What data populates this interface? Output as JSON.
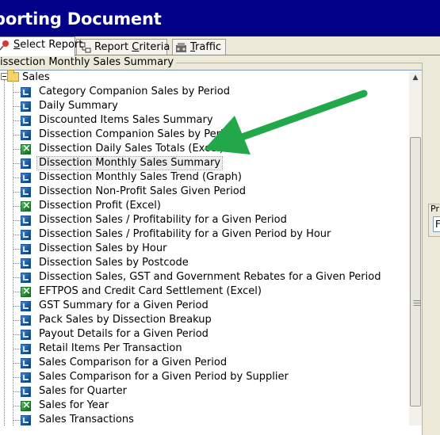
{
  "window": {
    "title": "eporting Document"
  },
  "tabs": [
    {
      "label_pre": "",
      "label_ul": "S",
      "label_post": "elect Report",
      "icon": "pin-icon",
      "active": true
    },
    {
      "label_pre": "Report ",
      "label_ul": "C",
      "label_post": "riteria",
      "icon": "criteria-icon",
      "active": false
    },
    {
      "label_pre": "",
      "label_ul": "T",
      "label_post": "raffic",
      "icon": "traffic-icon",
      "active": false
    }
  ],
  "group": {
    "label": "issection Monthly Sales Summary"
  },
  "tree": {
    "root": "Sales",
    "items": [
      {
        "label": "Category Companion Sales by Period",
        "icon": "report-icon"
      },
      {
        "label": "Daily Summary",
        "icon": "report-icon"
      },
      {
        "label": "Discounted Items Sales Summary",
        "icon": "report-icon"
      },
      {
        "label": "Dissection Companion Sales by Period",
        "icon": "report-icon"
      },
      {
        "label": "Dissection Daily Sales Totals (Excel)",
        "icon": "excel-icon"
      },
      {
        "label": "Dissection Monthly Sales Summary",
        "icon": "report-icon",
        "selected": true
      },
      {
        "label": "Dissection Monthly Sales Trend (Graph)",
        "icon": "report-icon"
      },
      {
        "label": "Dissection Non-Profit Sales Given Period",
        "icon": "report-icon"
      },
      {
        "label": "Dissection Profit (Excel)",
        "icon": "excel-icon"
      },
      {
        "label": "Dissection Sales / Profitability for a Given Period",
        "icon": "report-icon"
      },
      {
        "label": "Dissection Sales / Profitability for a Given Period by Hour",
        "icon": "report-icon"
      },
      {
        "label": "Dissection Sales by Hour",
        "icon": "report-icon"
      },
      {
        "label": "Dissection Sales by Postcode",
        "icon": "report-icon"
      },
      {
        "label": "Dissection Sales, GST and Government Rebates for a Given Period",
        "icon": "report-icon"
      },
      {
        "label": "EFTPOS and Credit Card Settlement (Excel)",
        "icon": "excel-icon"
      },
      {
        "label": "GST Summary for a Given Period",
        "icon": "report-icon"
      },
      {
        "label": "Pack Sales by Dissection Breakup",
        "icon": "report-icon"
      },
      {
        "label": "Payout Details for a Given Period",
        "icon": "report-icon"
      },
      {
        "label": "Retail Items Per Transaction",
        "icon": "report-icon"
      },
      {
        "label": "Sales Comparison for a Given Period",
        "icon": "report-icon"
      },
      {
        "label": "Sales Comparison for a Given Period by Supplier",
        "icon": "report-icon"
      },
      {
        "label": "Sales for Quarter",
        "icon": "report-icon"
      },
      {
        "label": "Sales for Year",
        "icon": "excel-icon"
      },
      {
        "label": "Sales Transactions",
        "icon": "report-icon"
      }
    ]
  },
  "right_panel": {
    "label": "Pri",
    "value": "F"
  },
  "colors": {
    "titlebar": "#020288",
    "annotation_arrow": "#22a84a"
  }
}
